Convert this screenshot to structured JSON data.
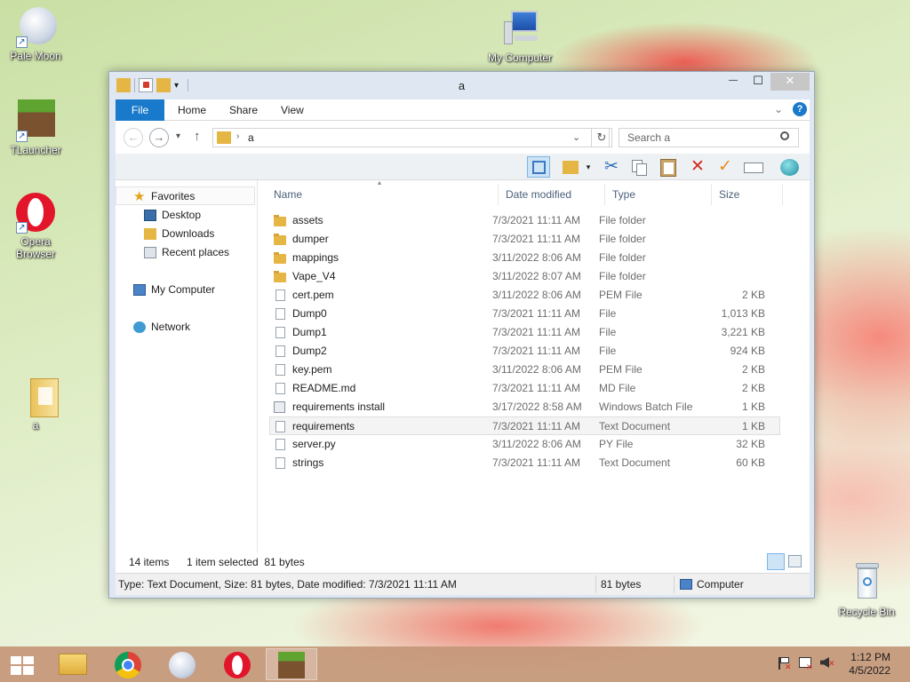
{
  "desktop": {
    "icons": [
      {
        "label": "Pale Moon"
      },
      {
        "label": "TLauncher"
      },
      {
        "label": "Opera Browser"
      },
      {
        "label": "a"
      },
      {
        "label": "My Computer"
      },
      {
        "label": "Recycle Bin"
      }
    ]
  },
  "window": {
    "title": "a",
    "controls": {
      "minimize": "—",
      "maximize": "☐",
      "close": "✕"
    },
    "ribbon_tabs": [
      "File",
      "Home",
      "Share",
      "View"
    ],
    "address": {
      "crumb": "a"
    },
    "search": {
      "placeholder": "Search a"
    },
    "nav_pane": {
      "favorites": "Favorites",
      "favorite_items": [
        "Desktop",
        "Downloads",
        "Recent places"
      ],
      "my_computer": "My Computer",
      "network": "Network"
    },
    "columns": {
      "name": "Name",
      "date": "Date modified",
      "type": "Type",
      "size": "Size"
    },
    "files": [
      {
        "name": "assets",
        "date": "7/3/2021 11:11 AM",
        "type": "File folder",
        "size": "",
        "kind": "folder"
      },
      {
        "name": "dumper",
        "date": "7/3/2021 11:11 AM",
        "type": "File folder",
        "size": "",
        "kind": "folder"
      },
      {
        "name": "mappings",
        "date": "3/11/2022 8:06 AM",
        "type": "File folder",
        "size": "",
        "kind": "folder"
      },
      {
        "name": "Vape_V4",
        "date": "3/11/2022 8:07 AM",
        "type": "File folder",
        "size": "",
        "kind": "folder"
      },
      {
        "name": "cert.pem",
        "date": "3/11/2022 8:06 AM",
        "type": "PEM File",
        "size": "2 KB",
        "kind": "file"
      },
      {
        "name": "Dump0",
        "date": "7/3/2021 11:11 AM",
        "type": "File",
        "size": "1,013 KB",
        "kind": "file"
      },
      {
        "name": "Dump1",
        "date": "7/3/2021 11:11 AM",
        "type": "File",
        "size": "3,221 KB",
        "kind": "file"
      },
      {
        "name": "Dump2",
        "date": "7/3/2021 11:11 AM",
        "type": "File",
        "size": "924 KB",
        "kind": "file"
      },
      {
        "name": "key.pem",
        "date": "3/11/2022 8:06 AM",
        "type": "PEM File",
        "size": "2 KB",
        "kind": "file"
      },
      {
        "name": "README.md",
        "date": "7/3/2021 11:11 AM",
        "type": "MD File",
        "size": "2 KB",
        "kind": "file"
      },
      {
        "name": "requirements install",
        "date": "3/17/2022 8:58 AM",
        "type": "Windows Batch File",
        "size": "1 KB",
        "kind": "bat"
      },
      {
        "name": "requirements",
        "date": "7/3/2021 11:11 AM",
        "type": "Text Document",
        "size": "1 KB",
        "kind": "file",
        "selected": true
      },
      {
        "name": "server.py",
        "date": "3/11/2022 8:06 AM",
        "type": "PY File",
        "size": "32 KB",
        "kind": "file"
      },
      {
        "name": "strings",
        "date": "7/3/2021 11:11 AM",
        "type": "Text Document",
        "size": "60 KB",
        "kind": "file"
      }
    ],
    "status": {
      "item_count": "14 items",
      "selection": "1 item selected  81 bytes",
      "details": "Type: Text Document, Size: 81 bytes, Date modified: 7/3/2021 11:11 AM",
      "size": "81 bytes",
      "location": "Computer"
    }
  },
  "taskbar": {
    "time": "1:12 PM",
    "date": "4/5/2022"
  },
  "colors": {
    "accent": "#1979ca",
    "folder": "#e6b645"
  }
}
